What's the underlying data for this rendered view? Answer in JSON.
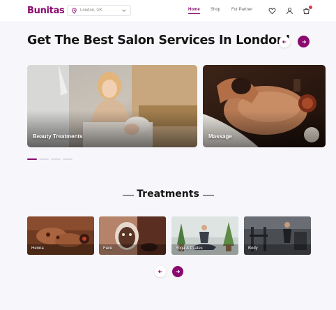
{
  "header": {
    "logo": "Bunitas",
    "location": "London, UK",
    "nav": {
      "home": "Home",
      "shop": "Shop",
      "partner": "For Partner"
    },
    "icons": [
      "heart-icon",
      "user-icon",
      "cart-icon"
    ]
  },
  "hero": {
    "title": "Get The Best Salon Services In London!",
    "cards": [
      {
        "label": "Beauty Treatments"
      },
      {
        "label": "Massage"
      }
    ]
  },
  "treatments": {
    "title": "Treatments",
    "items": [
      {
        "label": "Henna"
      },
      {
        "label": "Face"
      },
      {
        "label": "Yoga & Pilates"
      },
      {
        "label": "Body"
      }
    ]
  },
  "colors": {
    "brand": "#8a0a6e",
    "badge": "#e0383e",
    "background": "#f7f7fb"
  }
}
